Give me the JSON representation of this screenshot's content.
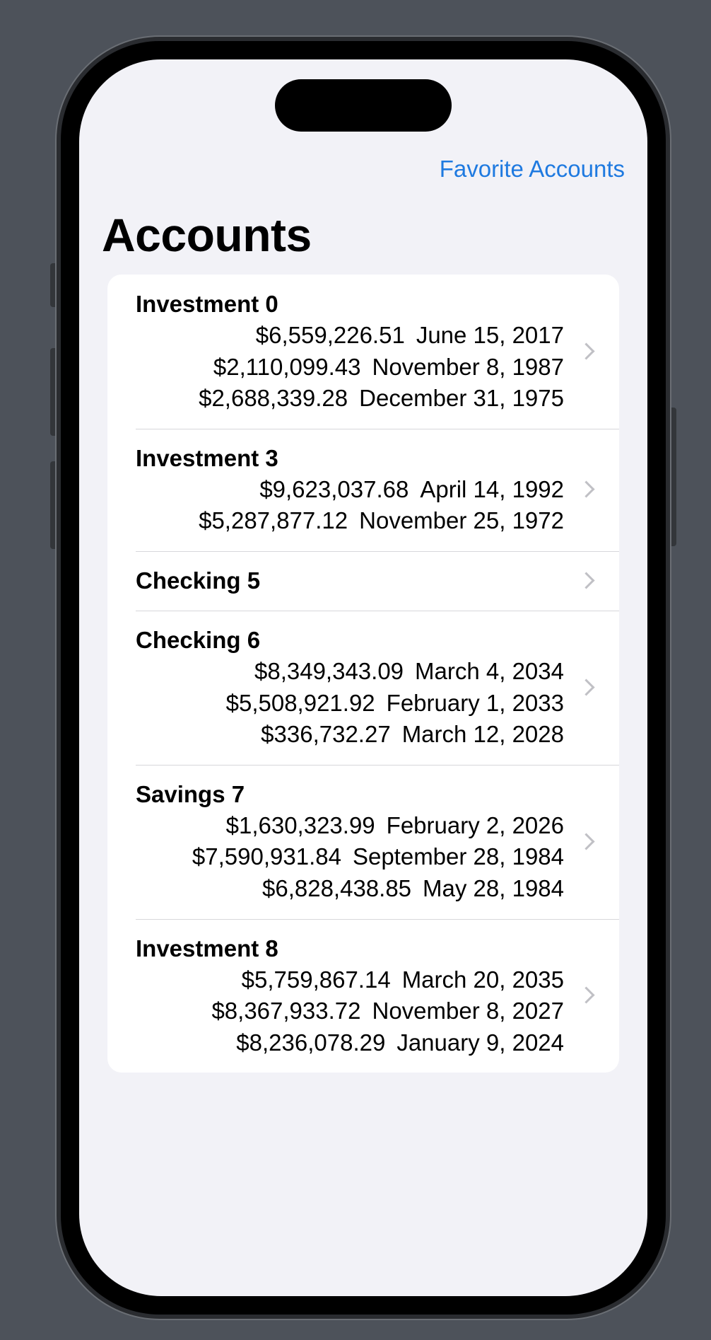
{
  "nav": {
    "favorites_label": "Favorite Accounts",
    "title": "Accounts"
  },
  "accounts": [
    {
      "name": "Investment 0",
      "entries": [
        {
          "amount": "$6,559,226.51",
          "date": "June 15, 2017"
        },
        {
          "amount": "$2,110,099.43",
          "date": "November 8, 1987"
        },
        {
          "amount": "$2,688,339.28",
          "date": "December 31, 1975"
        }
      ]
    },
    {
      "name": "Investment 3",
      "entries": [
        {
          "amount": "$9,623,037.68",
          "date": "April 14, 1992"
        },
        {
          "amount": "$5,287,877.12",
          "date": "November 25, 1972"
        }
      ]
    },
    {
      "name": "Checking 5",
      "entries": []
    },
    {
      "name": "Checking 6",
      "entries": [
        {
          "amount": "$8,349,343.09",
          "date": "March 4, 2034"
        },
        {
          "amount": "$5,508,921.92",
          "date": "February 1, 2033"
        },
        {
          "amount": "$336,732.27",
          "date": "March 12, 2028"
        }
      ]
    },
    {
      "name": "Savings 7",
      "entries": [
        {
          "amount": "$1,630,323.99",
          "date": "February 2, 2026"
        },
        {
          "amount": "$7,590,931.84",
          "date": "September 28, 1984"
        },
        {
          "amount": "$6,828,438.85",
          "date": "May 28, 1984"
        }
      ]
    },
    {
      "name": "Investment 8",
      "entries": [
        {
          "amount": "$5,759,867.14",
          "date": "March 20, 2035"
        },
        {
          "amount": "$8,367,933.72",
          "date": "November 8, 2027"
        },
        {
          "amount": "$8,236,078.29",
          "date": "January 9, 2024"
        }
      ]
    }
  ],
  "colors": {
    "accent": "#1f7ae0",
    "background": "#f2f2f7",
    "separator": "#d7d7db",
    "chevron": "#c0c0c5"
  },
  "icons": {
    "row_disclosure": "chevron-right-icon"
  }
}
